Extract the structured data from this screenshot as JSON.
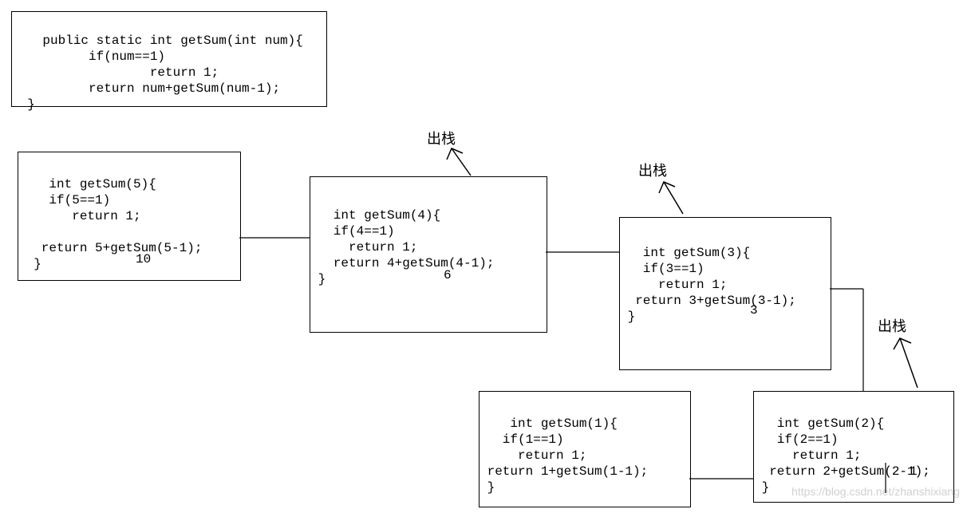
{
  "defBox": {
    "code": "  public static int getSum(int num){\n          if(num==1)\n                  return 1;\n          return num+getSum(num-1);\n  }"
  },
  "box5": {
    "code": "  int getSum(5){\n    if(5==1)\n       return 1;\n\n   return 5+getSum(5-1);\n  }",
    "result": "10"
  },
  "box4": {
    "code": " int getSum(4){\n   if(4==1)\n     return 1;\n   return 4+getSum(4-1);\n }",
    "result": "6"
  },
  "box3": {
    "code": " int getSum(3){\n   if(3==1)\n     return 1;\n  return 3+getSum(3-1);\n }",
    "result": "3"
  },
  "box2": {
    "code": " int getSum(2){\n   if(2==1)\n     return 1;\n  return 2+getSum(2-1);\n }",
    "result": "1"
  },
  "box1": {
    "code": "  int getSum(1){\n   if(1==1)\n     return 1;\n return 1+getSum(1-1);\n }"
  },
  "labels": {
    "pop1": "出栈",
    "pop2": "出栈",
    "pop3": "出栈"
  },
  "watermark": "https://blog.csdn.net/zhanshixiang"
}
